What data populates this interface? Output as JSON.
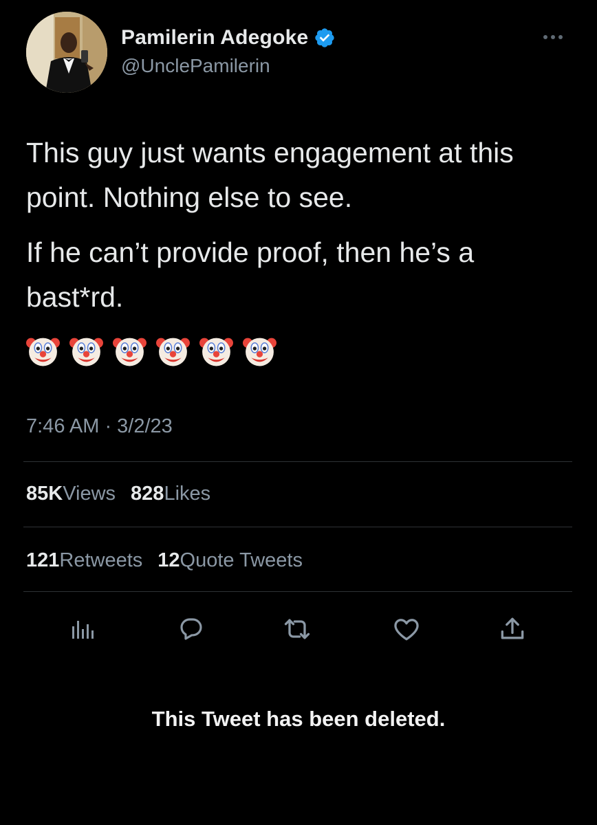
{
  "author": {
    "name": "Pamilerin Adegoke",
    "handle": "@UnclePamilerin",
    "verified": true,
    "verified_color": "#1d9bf0"
  },
  "tweet": {
    "paragraphs": [
      "This guy just wants engagement at this point. Nothing else to see.",
      "If he can’t provide proof, then he’s a bast*rd."
    ],
    "emoji_name": "clown-face",
    "emoji_count": 6,
    "timestamp": "7:46 AM · 3/2/23"
  },
  "stats": {
    "views_count": "85K",
    "views_label": "Views",
    "likes_count": "828",
    "likes_label": "Likes",
    "retweets_count": "121",
    "retweets_label": "Retweets",
    "quotes_count": "12",
    "quotes_label": "Quote Tweets"
  },
  "actions": [
    "analytics-icon",
    "reply-icon",
    "retweet-icon",
    "like-icon",
    "share-icon"
  ],
  "notice": "This Tweet has been deleted.",
  "colors": {
    "background": "#000000",
    "text": "#e7e9ea",
    "secondary": "#8b98a5",
    "divider": "#2f3336"
  }
}
